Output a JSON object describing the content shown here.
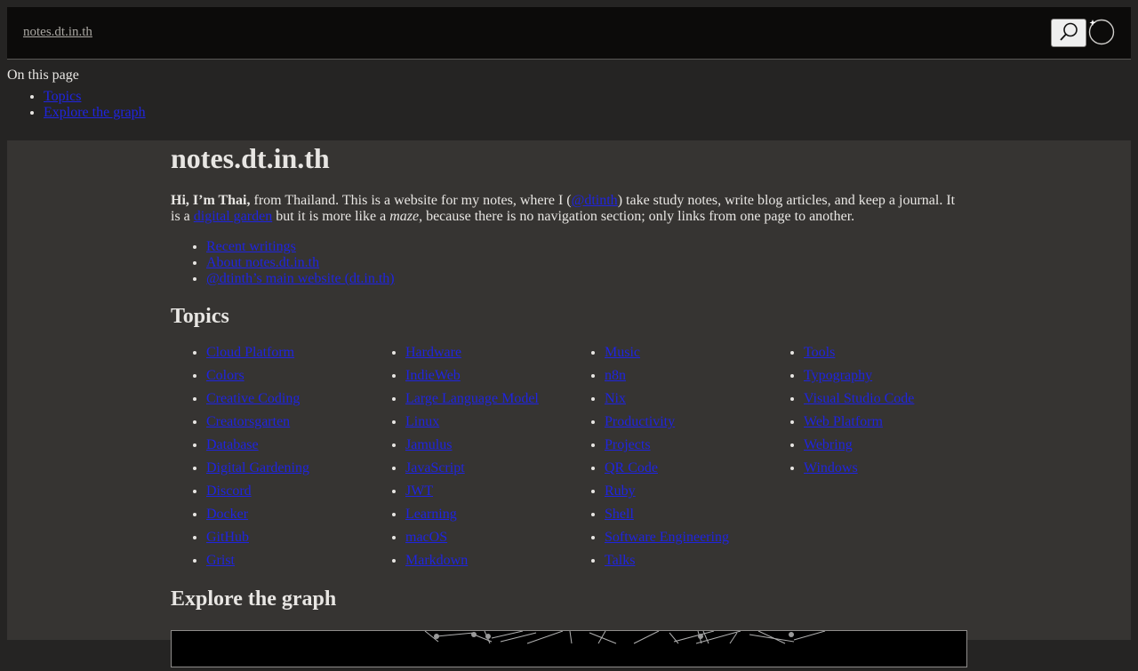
{
  "header": {
    "site_link": "notes.dt.in.th",
    "search_icon": "search-icon",
    "theme_icon": "theme-toggle-icon"
  },
  "toc": {
    "title": "On this page",
    "items": [
      "Topics",
      "Explore the graph"
    ]
  },
  "main": {
    "title": "notes.dt.in.th",
    "intro": {
      "bold": "Hi, I’m Thai,",
      "part1": " from Thailand. This is a website for my notes, where I (",
      "handle_link": "@dtinth",
      "part2": ") take study notes, write blog articles, and keep a journal. It is a ",
      "garden_link": "digital garden",
      "part3": " but it is more like a ",
      "maze": "maze",
      "part4": ", because there is no navigation section; only links from one page to another."
    },
    "quick_links": [
      "Recent writings",
      "About notes.dt.in.th",
      "@dtinth’s main website (dt.in.th)"
    ],
    "topics_heading": "Topics",
    "topic_columns": [
      [
        "Cloud Platform",
        "Colors",
        "Creative Coding",
        "Creatorsgarten",
        "Database",
        "Digital Gardening",
        "Discord",
        "Docker",
        "GitHub",
        "Grist"
      ],
      [
        "Hardware",
        "IndieWeb",
        "Large Language Model",
        "Linux",
        "Jamulus",
        "JavaScript",
        "JWT",
        "Learning",
        "macOS",
        "Markdown"
      ],
      [
        "Music",
        "n8n",
        "Nix",
        "Productivity",
        "Projects",
        "QR Code",
        "Ruby",
        "Shell",
        "Software Engineering",
        "Talks"
      ],
      [
        "Tools",
        "Typography",
        "Visual Studio Code",
        "Web Platform",
        "Webring",
        "Windows"
      ]
    ],
    "graph_heading": "Explore the graph"
  },
  "colors": {
    "background": "#252423",
    "content_background": "#363432",
    "header_background": "#0c0b0a",
    "link": "#1f24e0",
    "text": "#e8e6e3"
  }
}
